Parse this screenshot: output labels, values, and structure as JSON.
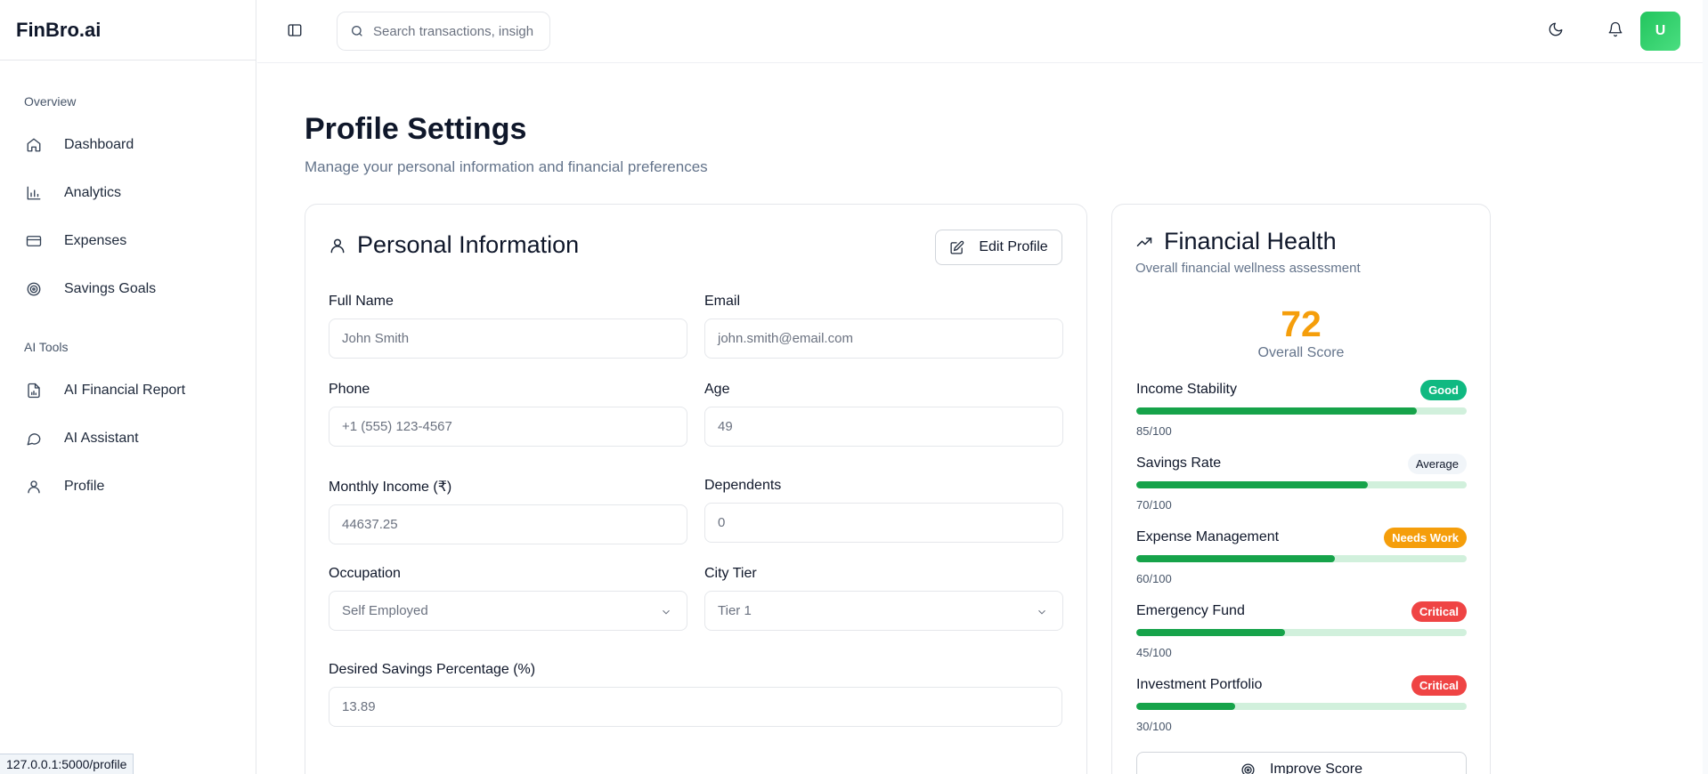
{
  "app": {
    "brand": "FinBro.ai"
  },
  "sidebar": {
    "section_overview": "Overview",
    "overview_items": [
      {
        "label": "Dashboard",
        "icon": "home-icon"
      },
      {
        "label": "Analytics",
        "icon": "bar-chart-icon"
      },
      {
        "label": "Expenses",
        "icon": "credit-card-icon"
      },
      {
        "label": "Savings Goals",
        "icon": "target-icon"
      }
    ],
    "section_ai": "AI Tools",
    "ai_items": [
      {
        "label": "AI Financial Report",
        "icon": "file-chart-icon"
      },
      {
        "label": "AI Assistant",
        "icon": "chat-bubble-icon"
      },
      {
        "label": "Profile",
        "icon": "user-icon"
      }
    ]
  },
  "header": {
    "search_placeholder": "Search transactions, insights...",
    "avatar_initial": "U"
  },
  "page": {
    "title": "Profile Settings",
    "subtitle": "Manage your personal information and financial preferences"
  },
  "personal": {
    "title": "Personal Information",
    "edit_label": "Edit Profile",
    "fields": {
      "full_name": {
        "label": "Full Name",
        "value": "John Smith"
      },
      "email": {
        "label": "Email",
        "value": "john.smith@email.com"
      },
      "phone": {
        "label": "Phone",
        "value": "+1 (555) 123-4567"
      },
      "age": {
        "label": "Age",
        "value": "49"
      },
      "income": {
        "label": "Monthly Income (₹)",
        "value": "44637.25"
      },
      "dependents": {
        "label": "Dependents",
        "value": "0"
      },
      "occupation": {
        "label": "Occupation",
        "value": "Self Employed"
      },
      "city_tier": {
        "label": "City Tier",
        "value": "Tier 1"
      },
      "savings_pct": {
        "label": "Desired Savings Percentage (%)",
        "value": "13.89"
      }
    }
  },
  "health": {
    "title": "Financial Health",
    "subtitle": "Overall financial wellness assessment",
    "score": "72",
    "score_label": "Overall Score",
    "metrics": [
      {
        "name": "Income Stability",
        "badge": "Good",
        "value": "85/100",
        "percent": 85
      },
      {
        "name": "Savings Rate",
        "badge": "Average",
        "value": "70/100",
        "percent": 70
      },
      {
        "name": "Expense Management",
        "badge": "Needs Work",
        "value": "60/100",
        "percent": 60
      },
      {
        "name": "Emergency Fund",
        "badge": "Critical",
        "value": "45/100",
        "percent": 45
      },
      {
        "name": "Investment Portfolio",
        "badge": "Critical",
        "value": "30/100",
        "percent": 30
      }
    ],
    "improve_label": "Improve Score"
  },
  "status_url": "127.0.0.1:5000/profile",
  "colors": {
    "score": "#f59e0b",
    "bar_fill": "#16a34a",
    "good": "#10b981",
    "needs_work": "#f59e0b",
    "critical": "#ef4444"
  }
}
